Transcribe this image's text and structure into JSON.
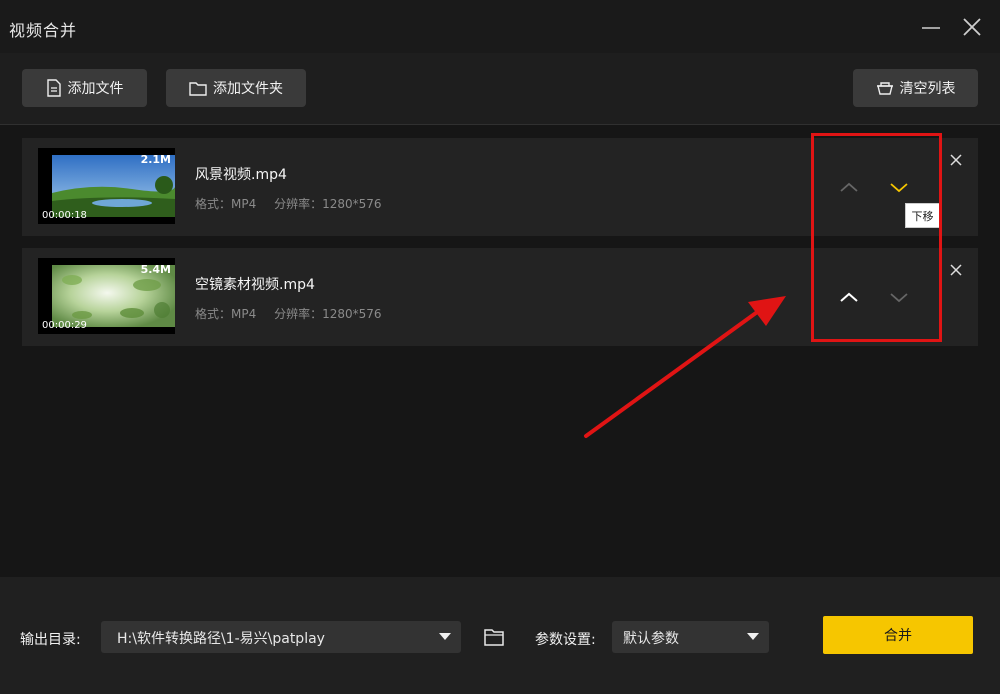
{
  "window": {
    "title": "视频合并"
  },
  "toolbar": {
    "add_file": "添加文件",
    "add_folder": "添加文件夹",
    "clear_list": "清空列表"
  },
  "files": [
    {
      "name": "风景视频.mp4",
      "size": "2.1M",
      "duration": "00:00:18",
      "format": "格式：MP4",
      "resolution": "分辨率：1280*576"
    },
    {
      "name": "空镜素材视频.mp4",
      "size": "5.4M",
      "duration": "00:00:29",
      "format": "格式：MP4",
      "resolution": "分辨率：1280*576"
    }
  ],
  "tooltip": "下移",
  "footer": {
    "output_label": "输出目录:",
    "output_path": "H:\\软件转换路径\\1-易兴\\patplay",
    "param_label": "参数设置:",
    "param_value": "默认参数",
    "merge": "合并"
  },
  "colors": {
    "accent": "#f6c600",
    "annotation": "#e01414",
    "down_active": "#f6c600"
  },
  "icons": {
    "add_file": "document-icon",
    "add_folder": "folder-icon",
    "clear_list": "basket-icon",
    "move_up": "chevron-up-icon",
    "move_down": "chevron-down-icon",
    "remove": "close-icon",
    "browse": "folder-icon"
  }
}
